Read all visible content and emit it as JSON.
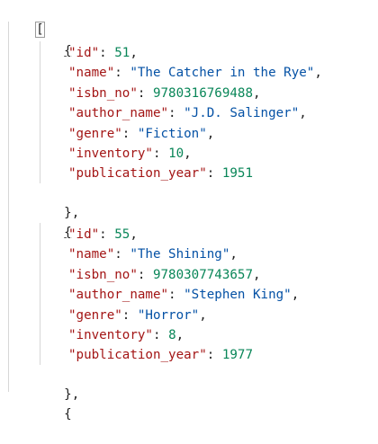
{
  "editor": {
    "open_bracket": "[",
    "objects": [
      {
        "open": "{",
        "close": "},",
        "fields": [
          {
            "key": "\"id\"",
            "sep": ": ",
            "value": "51",
            "type": "num",
            "trail": ","
          },
          {
            "key": "\"name\"",
            "sep": ": ",
            "value": "\"The Catcher in the Rye\"",
            "type": "str",
            "trail": ","
          },
          {
            "key": "\"isbn_no\"",
            "sep": ": ",
            "value": "9780316769488",
            "type": "num",
            "trail": ","
          },
          {
            "key": "\"author_name\"",
            "sep": ": ",
            "value": "\"J.D. Salinger\"",
            "type": "str",
            "trail": ","
          },
          {
            "key": "\"genre\"",
            "sep": ": ",
            "value": "\"Fiction\"",
            "type": "str",
            "trail": ","
          },
          {
            "key": "\"inventory\"",
            "sep": ": ",
            "value": "10",
            "type": "num",
            "trail": ","
          },
          {
            "key": "\"publication_year\"",
            "sep": ": ",
            "value": "1951",
            "type": "num",
            "trail": ""
          }
        ]
      },
      {
        "open": "{",
        "close": "},",
        "fields": [
          {
            "key": "\"id\"",
            "sep": ": ",
            "value": "55",
            "type": "num",
            "trail": ","
          },
          {
            "key": "\"name\"",
            "sep": ": ",
            "value": "\"The Shining\"",
            "type": "str",
            "trail": ","
          },
          {
            "key": "\"isbn_no\"",
            "sep": ": ",
            "value": "9780307743657",
            "type": "num",
            "trail": ","
          },
          {
            "key": "\"author_name\"",
            "sep": ": ",
            "value": "\"Stephen King\"",
            "type": "str",
            "trail": ","
          },
          {
            "key": "\"genre\"",
            "sep": ": ",
            "value": "\"Horror\"",
            "type": "str",
            "trail": ","
          },
          {
            "key": "\"inventory\"",
            "sep": ": ",
            "value": "8",
            "type": "num",
            "trail": ","
          },
          {
            "key": "\"publication_year\"",
            "sep": ": ",
            "value": "1977",
            "type": "num",
            "trail": ""
          }
        ]
      }
    ],
    "next_open": "{",
    "colors": {
      "key": "#a31515",
      "string": "#0451a5",
      "number": "#098658",
      "punctuation": "#1f1f1f",
      "indent_guide": "#d7d7d7"
    }
  }
}
